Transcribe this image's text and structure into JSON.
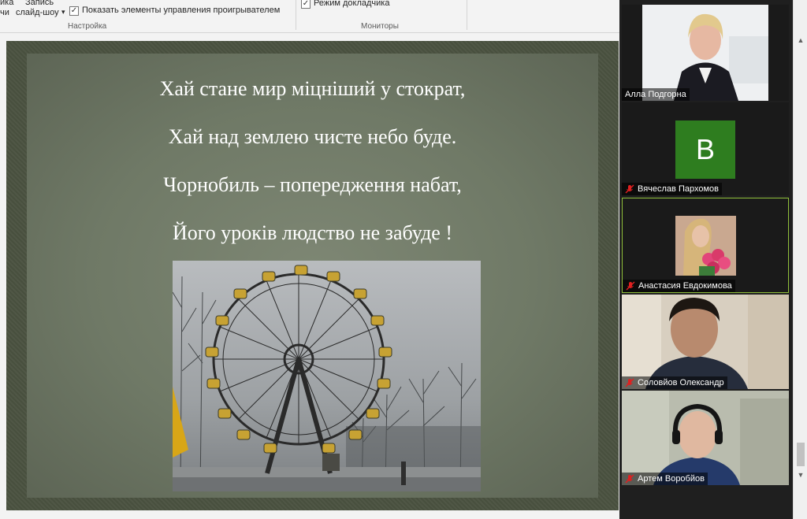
{
  "ribbon": {
    "partial_label_1": "ика",
    "partial_label_2": "чи",
    "record_label_line1": "Запись",
    "record_label_line2": "слайд-шоу",
    "record_dropdown": "▾",
    "show_controls": {
      "label": "Показать элементы управления проигрывателем",
      "checked": true
    },
    "presenter_mode": {
      "label": "Режим докладчика",
      "checked": true
    },
    "group_setup": "Настройка",
    "group_monitors": "Мониторы",
    "check_glyph": "✓"
  },
  "slide": {
    "lines": [
      "Хай стане мир міцніший у стократ,",
      "Хай над землею чисте небо буде.",
      "Чорнобиль – попередження набат,",
      "Його уроків людство не забуде !"
    ],
    "photo_icon": "ferris-wheel-photo"
  },
  "participants": [
    {
      "name": "Алла Подгорна",
      "muted": false,
      "video": true
    },
    {
      "name": "Вячеслав Пархомов",
      "muted": true,
      "video": false,
      "avatar_letter": "B",
      "avatar_color": "#2e7d1f"
    },
    {
      "name": "Анастасия Евдокимова",
      "muted": true,
      "video": true,
      "active": true
    },
    {
      "name": "Соловйов Олександр",
      "muted": true,
      "video": true
    },
    {
      "name": "Артем Воробйов",
      "muted": true,
      "video": true
    }
  ],
  "colors": {
    "mute_icon": "#e02020",
    "active_border": "#8fbf3a",
    "slide_bg": "#6f7966"
  },
  "scrollbar": {
    "up": "▲",
    "down": "▼"
  }
}
